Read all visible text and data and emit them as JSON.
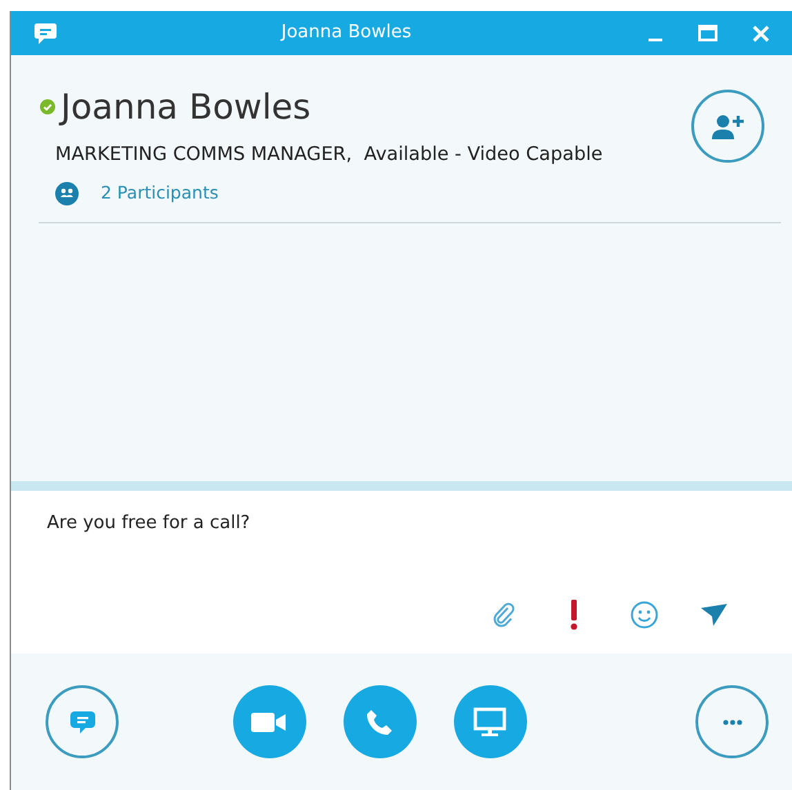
{
  "window": {
    "title": "Joanna Bowles"
  },
  "contact": {
    "name": "Joanna Bowles",
    "details": "MARKETING COMMS MANAGER,  Available - Video Capable",
    "participants": "2 Participants"
  },
  "compose": {
    "value": "Are you free for a call?"
  },
  "compose_tools": [
    {
      "kind": "attach"
    },
    {
      "kind": "important"
    },
    {
      "kind": "emoticon"
    },
    {
      "kind": "send"
    }
  ],
  "actions": [
    {
      "kind": "im",
      "filled": false
    },
    {
      "kind": "video",
      "filled": true
    },
    {
      "kind": "call",
      "filled": true
    },
    {
      "kind": "present",
      "filled": true
    },
    {
      "kind": "more",
      "filled": false
    }
  ]
}
